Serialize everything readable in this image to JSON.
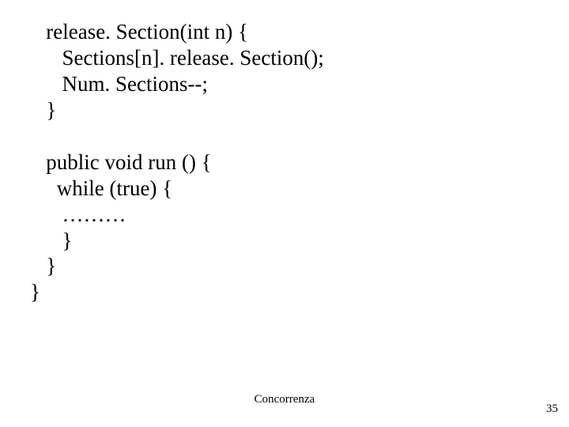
{
  "code": {
    "l1": "   release. Section(int n) {",
    "l2": "      Sections[n]. release. Section();",
    "l3": "      Num. Sections--;",
    "l4": "   }",
    "l5": "",
    "l6": "   public void run () {",
    "l7": "     while (true) {",
    "l8": "      ………",
    "l9": "      }",
    "l10": "   }",
    "l11": "}"
  },
  "footer": "Concorrenza",
  "page": "35"
}
